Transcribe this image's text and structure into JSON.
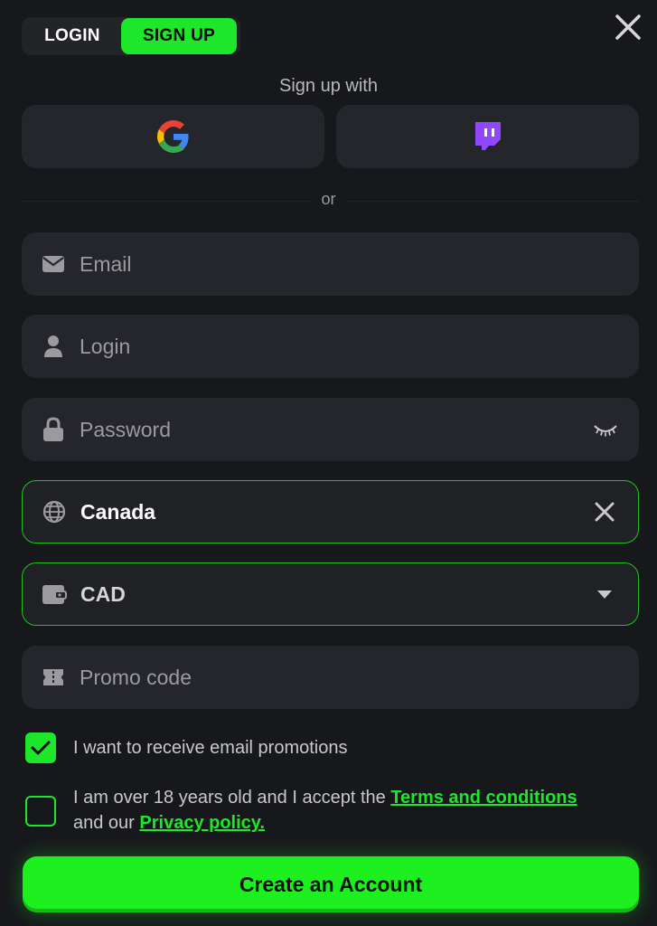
{
  "tabs": {
    "login": "LOGIN",
    "signup": "SIGN UP",
    "active": "signup"
  },
  "signup_with": "Sign up with",
  "divider_text": "or",
  "fields": {
    "email": {
      "placeholder": "Email",
      "icon": "envelope-icon"
    },
    "login": {
      "placeholder": "Login",
      "icon": "user-icon"
    },
    "password": {
      "placeholder": "Password",
      "icon": "lock-icon",
      "trailing_icon": "eye-closed-icon"
    },
    "country": {
      "value": "Canada",
      "icon": "globe-icon",
      "trailing_icon": "clear-icon"
    },
    "currency": {
      "value": "CAD",
      "icon": "wallet-icon",
      "trailing_icon": "caret-down-icon"
    },
    "promo": {
      "placeholder": "Promo code",
      "icon": "ticket-icon"
    }
  },
  "checkboxes": {
    "email_promotions": {
      "label": "I want to receive email promotions",
      "checked": true
    },
    "age_terms": {
      "label_before": "I am over 18 years old and I accept the ",
      "terms_link": "Terms and conditions",
      "label_middle": "and our ",
      "privacy_link": "Privacy policy.",
      "checked": false
    }
  },
  "submit_label": "Create an Account",
  "colors": {
    "accent": "#1ee62a",
    "background": "#17181c",
    "field": "#25262b"
  }
}
